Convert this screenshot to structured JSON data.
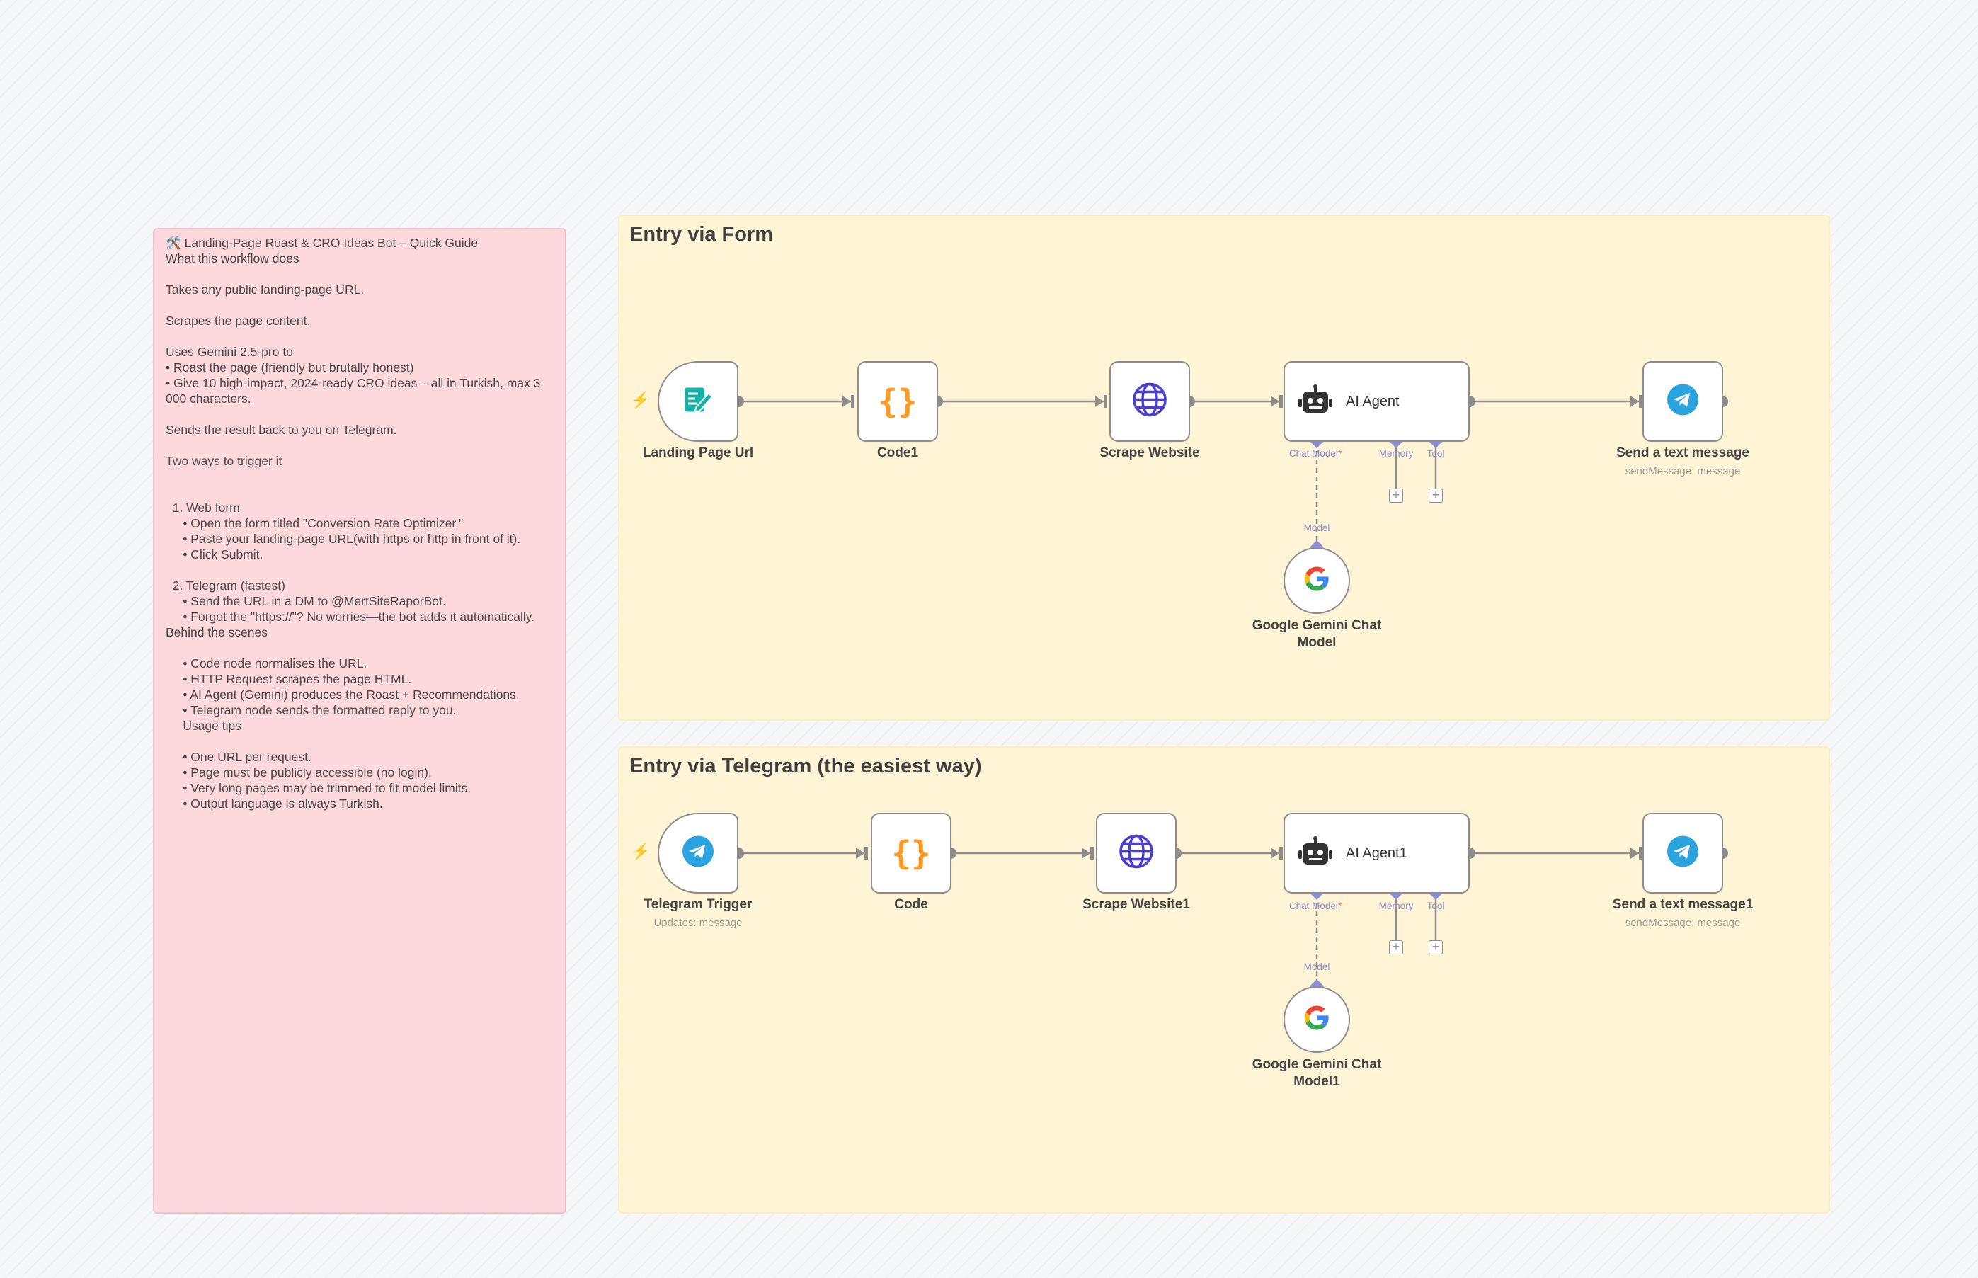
{
  "guide": {
    "lines": [
      "🛠️ Landing-Page Roast & CRO Ideas Bot – Quick Guide",
      "What this workflow does",
      "",
      "Takes any public landing-page URL.",
      "",
      "Scrapes the page content.",
      "",
      "Uses Gemini 2.5-pro to",
      "• Roast the page (friendly but brutally honest)",
      "• Give 10 high-impact, 2024-ready CRO ideas – all in Turkish, max 3 000 characters.",
      "",
      "Sends the result back to you on Telegram.",
      "",
      "Two ways to trigger it",
      "",
      "",
      "  1. Web form",
      "     • Open the form titled \"Conversion Rate Optimizer.\"",
      "     • Paste your landing-page URL(with https or http in front of it).",
      "     • Click Submit.",
      "",
      "  2. Telegram (fastest)",
      "     • Send the URL in a DM to @MertSiteRaporBot.",
      "     • Forgot the \"https://\"? No worries—the bot adds it automatically.",
      "Behind the scenes",
      "",
      "     • Code node normalises the URL.",
      "     • HTTP Request scrapes the page HTML.",
      "     • AI Agent (Gemini) produces the Roast + Recommendations.",
      "     • Telegram node sends the formatted reply to you.",
      "     Usage tips",
      "",
      "     • One URL per request.",
      "     • Page must be publicly accessible (no login).",
      "     • Very long pages may be trimmed to fit model limits.",
      "     • Output language is always Turkish."
    ]
  },
  "sections": {
    "form": {
      "title": "Entry via Form"
    },
    "telegram": {
      "title": "Entry via Telegram (the easiest way)"
    }
  },
  "nodes": {
    "landing_page_url": {
      "label": "Landing Page Url"
    },
    "code1": {
      "label": "Code1"
    },
    "scrape_website": {
      "label": "Scrape Website"
    },
    "ai_agent": {
      "label": "AI Agent"
    },
    "send_text_message": {
      "label": "Send a text message",
      "subtitle": "sendMessage: message"
    },
    "gemini_chat_model": {
      "label": "Google Gemini Chat Model"
    },
    "telegram_trigger": {
      "label": "Telegram Trigger",
      "subtitle": "Updates: message"
    },
    "code": {
      "label": "Code"
    },
    "scrape_website1": {
      "label": "Scrape Website1"
    },
    "ai_agent1": {
      "label": "AI Agent1"
    },
    "send_text_message1": {
      "label": "Send a text message1",
      "subtitle": "sendMessage: message"
    },
    "gemini_chat_model1": {
      "label": "Google Gemini Chat Model1"
    }
  },
  "ports": {
    "chat_model": "Chat Model",
    "required_mark": "*",
    "memory": "Memory",
    "tool": "Tool",
    "model": "Model"
  },
  "icons": {
    "form_trigger": "form-edit-icon",
    "code": "code-braces-icon",
    "http": "globe-icon",
    "agent": "robot-icon",
    "telegram": "telegram-icon",
    "gemini": "google-icon",
    "trigger_marker": "lightning-bolt-icon",
    "add": "plus-icon"
  },
  "colors": {
    "guide_note": "#fdd8dc",
    "section_note": "#fff4d6",
    "connection": "#8d8d8d",
    "ai_port": "#8a8fd3",
    "trigger_bolt": "#ff6d5a",
    "code_icon": "#ff9922",
    "globe_icon": "#4b3fcf",
    "telegram_icon": "#2aa3df",
    "form_icon": "#16b2a8"
  }
}
